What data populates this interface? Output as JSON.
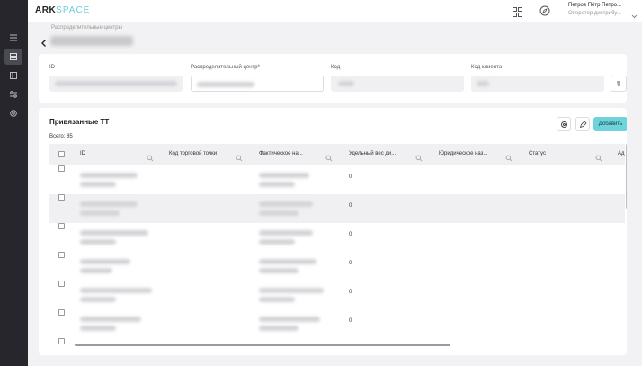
{
  "logo": {
    "part_a": "ARK",
    "part_b": "SPACE"
  },
  "user": {
    "name": "Петров Пётр Петро...",
    "role": "Оператор дистрибу..."
  },
  "breadcrumb": "Распределительные центры",
  "fields": {
    "id_label": "ID",
    "dc_label": "Распределительный центр*",
    "code_label": "Код",
    "client_code_label": "Код клиента"
  },
  "section": {
    "title": "Привязанные ТТ",
    "total": "Всего: 85",
    "add_label": "Добавить"
  },
  "table": {
    "columns": [
      "ID",
      "Код торговой точки",
      "Фактическое на...",
      "Удельный вес ди...",
      "Юридическое наз...",
      "Статус",
      "Ад"
    ],
    "rows": [
      {
        "weight": "0"
      },
      {
        "weight": "0"
      },
      {
        "weight": "0"
      },
      {
        "weight": "0"
      },
      {
        "weight": "0"
      },
      {
        "weight": "0"
      }
    ]
  },
  "colors": {
    "accent": "#6fd3dc",
    "rail": "#26262c"
  },
  "icons": [
    "menu-list-icon",
    "database-icon",
    "panel-icon",
    "sliders-icon",
    "settings-icon",
    "apps-grid-icon",
    "compass-icon",
    "chevron-down-icon",
    "back-arrow-icon",
    "sort-icon",
    "gear-icon",
    "edit-icon",
    "search-icon"
  ]
}
